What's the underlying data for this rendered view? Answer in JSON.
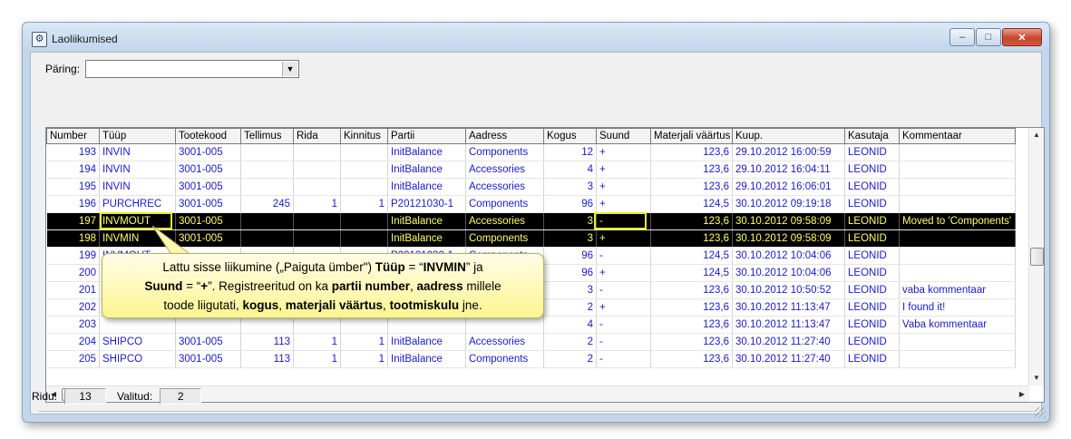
{
  "window": {
    "title": "Laoliikumised",
    "minimize_glyph": "–",
    "maximize_glyph": "□",
    "close_glyph": "✕",
    "icon": "gear-app-icon"
  },
  "query": {
    "label": "Päring:",
    "value": ""
  },
  "grid": {
    "columns": [
      "Number",
      "Tüüp",
      "Tootekood",
      "Tellimus",
      "Rida",
      "Kinnitus",
      "Partii",
      "Aadress",
      "Kogus",
      "Suund",
      "Materjali väärtus",
      "Kuup.",
      "Kasutaja",
      "Kommentaar"
    ],
    "rows": [
      {
        "number": "193",
        "tyyp": "INVIN",
        "tootekood": "3001-005",
        "tellimus": "",
        "rida": "",
        "kinnitus": "",
        "partii": "InitBalance",
        "aadress": "Components",
        "kogus": "12",
        "suund": "+",
        "vaartus": "123,6",
        "kuup": "29.10.2012 16:00:59",
        "kasutaja": "LEONID",
        "kommentaar": ""
      },
      {
        "number": "194",
        "tyyp": "INVIN",
        "tootekood": "3001-005",
        "tellimus": "",
        "rida": "",
        "kinnitus": "",
        "partii": "InitBalance",
        "aadress": "Accessories",
        "kogus": "4",
        "suund": "+",
        "vaartus": "123,6",
        "kuup": "29.10.2012 16:04:11",
        "kasutaja": "LEONID",
        "kommentaar": ""
      },
      {
        "number": "195",
        "tyyp": "INVIN",
        "tootekood": "3001-005",
        "tellimus": "",
        "rida": "",
        "kinnitus": "",
        "partii": "InitBalance",
        "aadress": "Accessories",
        "kogus": "3",
        "suund": "+",
        "vaartus": "123,6",
        "kuup": "29.10.2012 16:06:01",
        "kasutaja": "LEONID",
        "kommentaar": ""
      },
      {
        "number": "196",
        "tyyp": "PURCHREC",
        "tootekood": "3001-005",
        "tellimus": "245",
        "rida": "1",
        "kinnitus": "1",
        "partii": "P20121030-1",
        "aadress": "Components",
        "kogus": "96",
        "suund": "+",
        "vaartus": "124,5",
        "kuup": "30.10.2012 09:19:18",
        "kasutaja": "LEONID",
        "kommentaar": ""
      },
      {
        "number": "197",
        "tyyp": "INVMOUT",
        "tootekood": "3001-005",
        "tellimus": "",
        "rida": "",
        "kinnitus": "",
        "partii": "InitBalance",
        "aadress": "Accessories",
        "kogus": "3",
        "suund": "-",
        "vaartus": "123,6",
        "kuup": "30.10.2012 09:58:09",
        "kasutaja": "LEONID",
        "kommentaar": "Moved to 'Components'"
      },
      {
        "number": "198",
        "tyyp": "INVMIN",
        "tootekood": "3001-005",
        "tellimus": "",
        "rida": "",
        "kinnitus": "",
        "partii": "InitBalance",
        "aadress": "Components",
        "kogus": "3",
        "suund": "+",
        "vaartus": "123,6",
        "kuup": "30.10.2012 09:58:09",
        "kasutaja": "LEONID",
        "kommentaar": ""
      },
      {
        "number": "199",
        "tyyp": "INVMOUT",
        "tootekood": "",
        "tellimus": "",
        "rida": "",
        "kinnitus": "",
        "partii": "P20121030-1",
        "aadress": "Components",
        "kogus": "96",
        "suund": "-",
        "vaartus": "124,5",
        "kuup": "30.10.2012 10:04:06",
        "kasutaja": "LEONID",
        "kommentaar": ""
      },
      {
        "number": "200",
        "tyyp": "",
        "tootekood": "",
        "tellimus": "",
        "rida": "",
        "kinnitus": "",
        "partii": "",
        "aadress": "",
        "kogus": "96",
        "suund": "+",
        "vaartus": "124,5",
        "kuup": "30.10.2012 10:04:06",
        "kasutaja": "LEONID",
        "kommentaar": ""
      },
      {
        "number": "201",
        "tyyp": "",
        "tootekood": "",
        "tellimus": "",
        "rida": "",
        "kinnitus": "",
        "partii": "",
        "aadress": "",
        "kogus": "3",
        "suund": "-",
        "vaartus": "123,6",
        "kuup": "30.10.2012 10:50:52",
        "kasutaja": "LEONID",
        "kommentaar": "vaba kommentaar"
      },
      {
        "number": "202",
        "tyyp": "",
        "tootekood": "",
        "tellimus": "",
        "rida": "",
        "kinnitus": "",
        "partii": "",
        "aadress": "",
        "kogus": "2",
        "suund": "+",
        "vaartus": "123,6",
        "kuup": "30.10.2012 11:13:47",
        "kasutaja": "LEONID",
        "kommentaar": "I found it!"
      },
      {
        "number": "203",
        "tyyp": "",
        "tootekood": "",
        "tellimus": "",
        "rida": "",
        "kinnitus": "",
        "partii": "",
        "aadress": "",
        "kogus": "4",
        "suund": "-",
        "vaartus": "123,6",
        "kuup": "30.10.2012 11:13:47",
        "kasutaja": "LEONID",
        "kommentaar": "Vaba kommentaar"
      },
      {
        "number": "204",
        "tyyp": "SHIPCO",
        "tootekood": "3001-005",
        "tellimus": "113",
        "rida": "1",
        "kinnitus": "1",
        "partii": "InitBalance",
        "aadress": "Accessories",
        "kogus": "2",
        "suund": "-",
        "vaartus": "123,6",
        "kuup": "30.10.2012 11:27:40",
        "kasutaja": "LEONID",
        "kommentaar": ""
      },
      {
        "number": "205",
        "tyyp": "SHIPCO",
        "tootekood": "3001-005",
        "tellimus": "113",
        "rida": "1",
        "kinnitus": "1",
        "partii": "InitBalance",
        "aadress": "Components",
        "kogus": "2",
        "suund": "-",
        "vaartus": "123,6",
        "kuup": "30.10.2012 11:27:40",
        "kasutaja": "LEONID",
        "kommentaar": ""
      }
    ],
    "selected_rows": [
      4,
      5
    ]
  },
  "callout": {
    "line1_a": "Lattu sisse liikumine („Paiguta ümber\") ",
    "line1_b": "Tüüp",
    "line1_c": " = “",
    "line1_d": "INVMIN",
    "line1_e": "” ja",
    "line2_a": "Suund",
    "line2_b": " = “",
    "line2_c": "+",
    "line2_d": "”.  Registreeritud on ka ",
    "line2_e": "partii number",
    "line2_f": ", ",
    "line2_g": "aadress",
    "line2_h": " millele",
    "line3_a": "toode liigutati, ",
    "line3_b": "kogus",
    "line3_c": ", ",
    "line3_d": "materjali väärtus",
    "line3_e": ", ",
    "line3_f": "tootmiskulu",
    "line3_g": " jne."
  },
  "status": {
    "rows_label": "Ridu:",
    "rows_value": "13",
    "selected_label": "Valitud:",
    "selected_value": "2"
  },
  "colors": {
    "cell_text": "#1a1acc",
    "selected_bg": "#000000",
    "selected_text": "#ffff66",
    "highlight": "#e6ee27",
    "callout_bg": "#fdf592"
  }
}
